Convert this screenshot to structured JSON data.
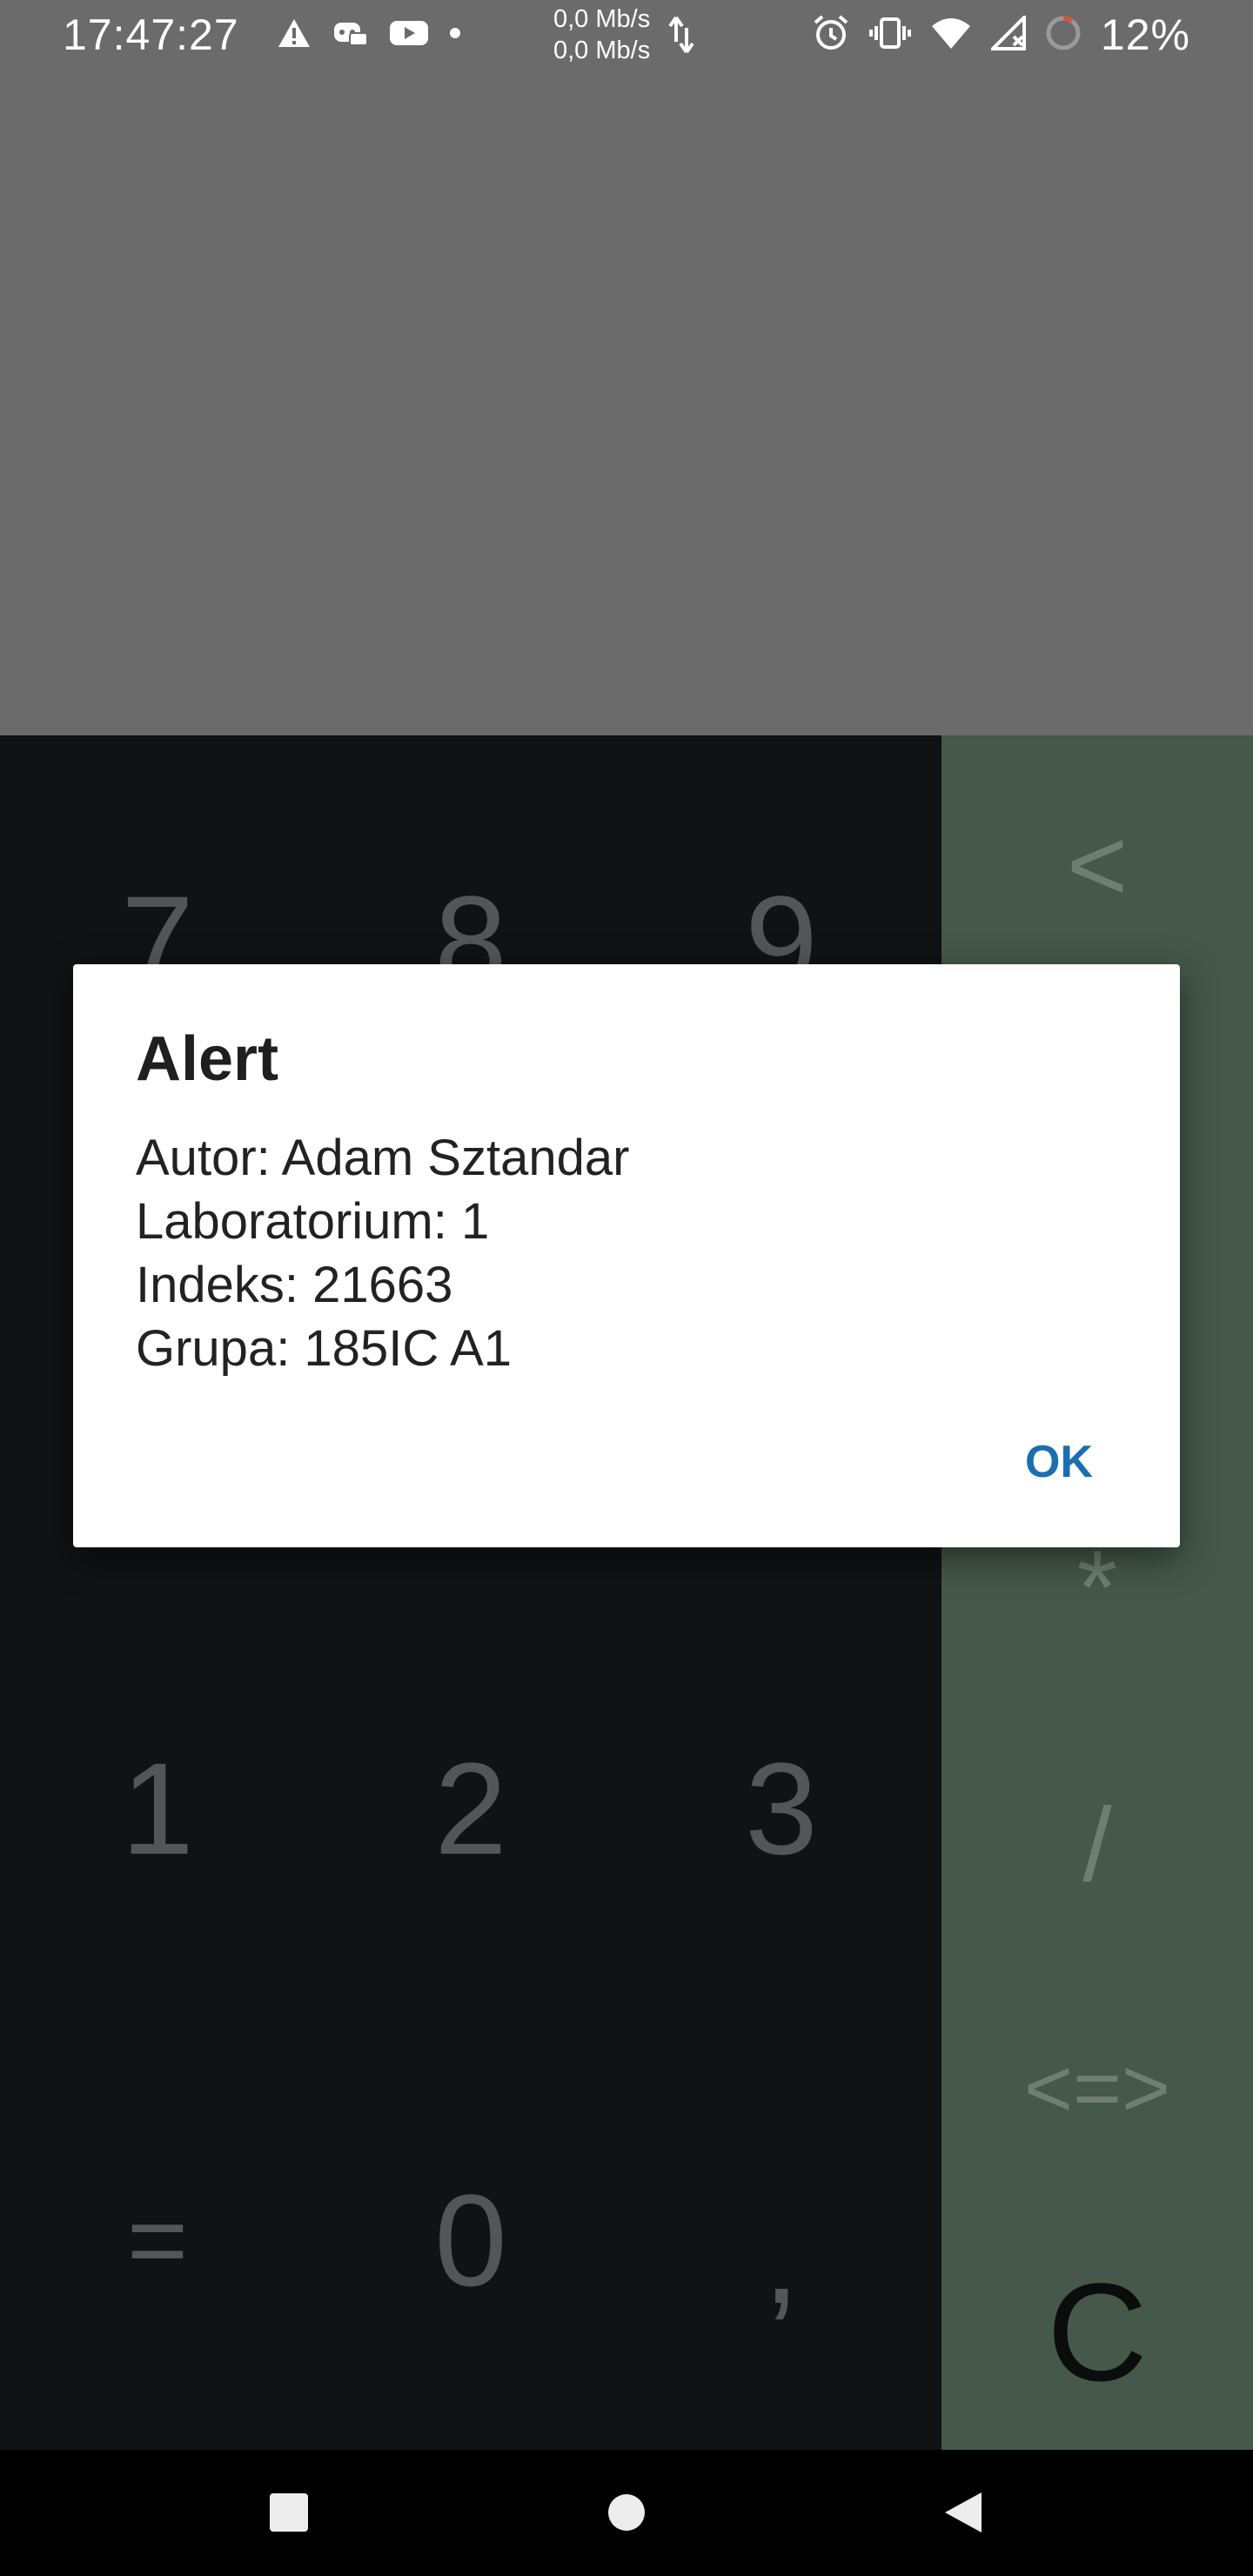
{
  "status_bar": {
    "time": "17:47:27",
    "net_up": "0,0 Mb/s",
    "net_down": "0,0 Mb/s",
    "battery": "12%",
    "icons_left": [
      "warning-icon",
      "discord-icon",
      "youtube-icon",
      "dot-icon"
    ],
    "icons_right": [
      "alarm-icon",
      "vibrate-icon",
      "wifi-icon",
      "signal-icon",
      "battery-ring-icon"
    ]
  },
  "keypad": {
    "row1": [
      "7",
      "8",
      "9"
    ],
    "row4": [
      "1",
      "2",
      "3"
    ],
    "row5": [
      "=",
      "0",
      ","
    ]
  },
  "operators": {
    "back": "<",
    "multiply": "*",
    "divide": "/",
    "compare": "<=>",
    "clear": "C"
  },
  "dialog": {
    "title": "Alert",
    "lines": [
      "Autor: Adam Sztandar",
      "Laboratorium: 1",
      "Indeks: 21663",
      "Grupa: 185IC A1"
    ],
    "ok_label": "OK"
  },
  "colors": {
    "display_bg": "#6b6b6b",
    "keypad_bg": "#111214",
    "ops_bg": "#45584a",
    "accent": "#1a6fae"
  }
}
